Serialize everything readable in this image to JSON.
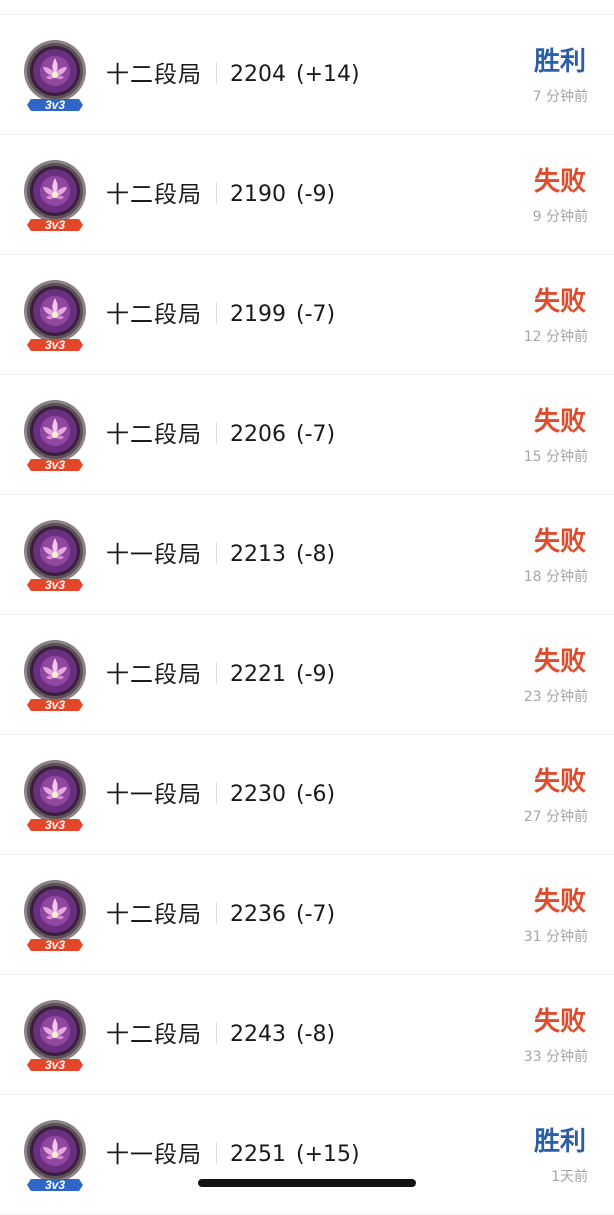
{
  "colors": {
    "win": "#2a5fa8",
    "lose": "#e04d2d",
    "time": "#a6a6a6",
    "badge_ring": "#7a6f73",
    "badge_core": "#6a2f7f",
    "badge_ribbon_blue": "#2f66c8",
    "badge_ribbon_orange": "#e2472a"
  },
  "matches": [
    {
      "mode": "3v3",
      "mode_icon": "lotus-arena-badge-icon",
      "rank": "十二段局",
      "score": "2204",
      "delta": "(+14)",
      "result": "胜利",
      "outcome": "win",
      "time": "7 分钟前"
    },
    {
      "mode": "3v3",
      "mode_icon": "lotus-arena-badge-icon",
      "rank": "十二段局",
      "score": "2190",
      "delta": "(-9)",
      "result": "失败",
      "outcome": "lose",
      "time": "9 分钟前"
    },
    {
      "mode": "3v3",
      "mode_icon": "lotus-arena-badge-icon",
      "rank": "十二段局",
      "score": "2199",
      "delta": "(-7)",
      "result": "失败",
      "outcome": "lose",
      "time": "12 分钟前"
    },
    {
      "mode": "3v3",
      "mode_icon": "lotus-arena-badge-icon",
      "rank": "十二段局",
      "score": "2206",
      "delta": "(-7)",
      "result": "失败",
      "outcome": "lose",
      "time": "15 分钟前"
    },
    {
      "mode": "3v3",
      "mode_icon": "lotus-arena-badge-icon",
      "rank": "十一段局",
      "score": "2213",
      "delta": "(-8)",
      "result": "失败",
      "outcome": "lose",
      "time": "18 分钟前"
    },
    {
      "mode": "3v3",
      "mode_icon": "lotus-arena-badge-icon",
      "rank": "十二段局",
      "score": "2221",
      "delta": "(-9)",
      "result": "失败",
      "outcome": "lose",
      "time": "23 分钟前"
    },
    {
      "mode": "3v3",
      "mode_icon": "lotus-arena-badge-icon",
      "rank": "十一段局",
      "score": "2230",
      "delta": "(-6)",
      "result": "失败",
      "outcome": "lose",
      "time": "27 分钟前"
    },
    {
      "mode": "3v3",
      "mode_icon": "lotus-arena-badge-icon",
      "rank": "十二段局",
      "score": "2236",
      "delta": "(-7)",
      "result": "失败",
      "outcome": "lose",
      "time": "31 分钟前"
    },
    {
      "mode": "3v3",
      "mode_icon": "lotus-arena-badge-icon",
      "rank": "十二段局",
      "score": "2243",
      "delta": "(-8)",
      "result": "失败",
      "outcome": "lose",
      "time": "33 分钟前"
    },
    {
      "mode": "3v3",
      "mode_icon": "lotus-arena-badge-icon",
      "rank": "十一段局",
      "score": "2251",
      "delta": "(+15)",
      "result": "胜利",
      "outcome": "win",
      "time": "1天前"
    }
  ]
}
